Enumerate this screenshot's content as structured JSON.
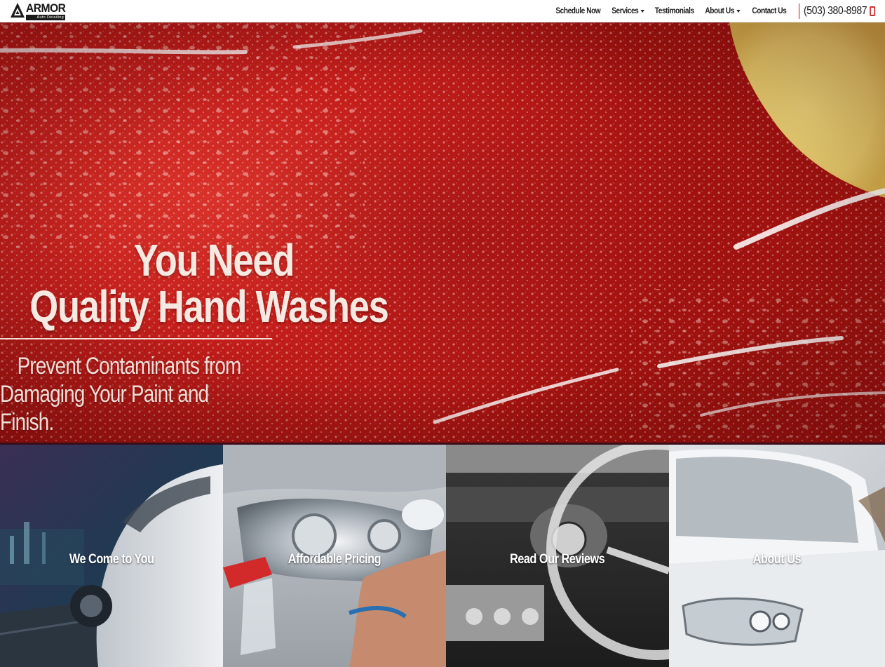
{
  "brand": {
    "name": "ARMOR",
    "tagline": "Auto Detailing",
    "accent_color": "#c41e1b"
  },
  "nav": {
    "items": [
      {
        "label": "Schedule Now",
        "dropdown": false
      },
      {
        "label": "Services",
        "dropdown": true
      },
      {
        "label": "Testimonials",
        "dropdown": false
      },
      {
        "label": "About Us",
        "dropdown": true
      },
      {
        "label": "Contact Us",
        "dropdown": false
      }
    ],
    "phone": "(503) 380-8987",
    "phone_icon": "mobile-phone-icon"
  },
  "hero": {
    "heading_line1": "You Need",
    "heading_line2": "Quality Hand Washes",
    "subheading_line1": "Prevent Contaminants from",
    "subheading_line2": "Damaging Your Paint and Finish."
  },
  "tiles": [
    {
      "label": "We Come to You"
    },
    {
      "label": "Affordable Pricing"
    },
    {
      "label": "Read Our Reviews"
    },
    {
      "label": "About Us"
    }
  ]
}
